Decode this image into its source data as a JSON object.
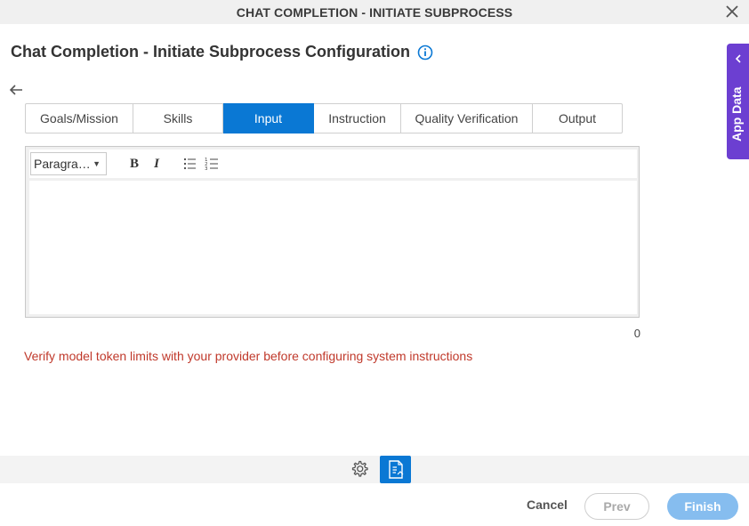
{
  "window": {
    "title": "CHAT COMPLETION - INITIATE SUBPROCESS"
  },
  "page": {
    "heading": "Chat Completion - Initiate Subprocess Configuration"
  },
  "tabs": [
    {
      "label": "Goals/Mission",
      "active": false
    },
    {
      "label": "Skills",
      "active": false
    },
    {
      "label": "Input",
      "active": true
    },
    {
      "label": "Instruction",
      "active": false
    },
    {
      "label": "Quality Verification",
      "active": false
    },
    {
      "label": "Output",
      "active": false
    }
  ],
  "editor": {
    "format_value": "Paragra…",
    "bold_label": "B",
    "italic_label": "I",
    "char_count": "0"
  },
  "warning": "Verify model token limits with your provider before configuring system instructions",
  "footer": {
    "cancel": "Cancel",
    "prev": "Prev",
    "finish": "Finish"
  },
  "side_panel": {
    "label": "App Data"
  },
  "colors": {
    "accent": "#0a78d4",
    "side_panel": "#6c3fd1",
    "warning": "#c0392b"
  },
  "icons": [
    "close-icon",
    "info-icon",
    "back-arrow-icon",
    "bullet-list-icon",
    "numbered-list-icon",
    "gear-icon",
    "document-icon",
    "chevron-left-icon"
  ]
}
